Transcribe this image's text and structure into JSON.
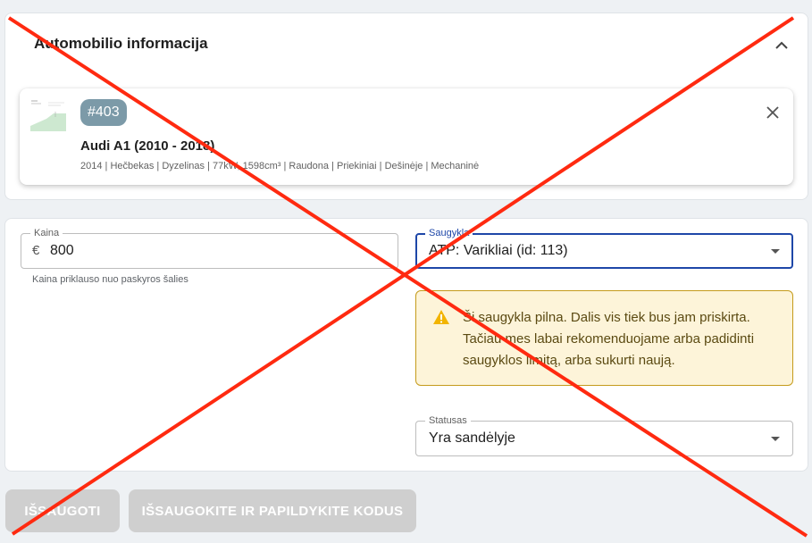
{
  "vehicle_section": {
    "title": "Automobilio informacija",
    "card": {
      "badge": "#403",
      "title": "Audi A1 (2010 - 2018)",
      "details": "2014 | Hečbekas | Dyzelinas | 77kW, 1598cm³ | Raudona | Priekiniai | Dešinėje | Mechaninė"
    }
  },
  "form": {
    "price": {
      "label": "Kaina",
      "currency": "€",
      "value": "800",
      "helper": "Kaina priklauso nuo paskyros šalies"
    },
    "storage": {
      "label": "Saugykla",
      "value": "ATP: Varikliai (id: 113)"
    },
    "warning": {
      "text": "Ši saugykla pilna. Dalis vis tiek bus jam priskirta. Tačiau mes labai rekomenduojame arba padidinti saugyklos limitą, arba sukurti naują."
    },
    "status": {
      "label": "Statusas",
      "value": "Yra sandėlyje"
    }
  },
  "actions": {
    "save_label": "IŠSAUGOTI",
    "save_codes_label": "IŠSAUGOKITE IR PAPILDYKITE KODUS"
  },
  "colors": {
    "background": "#eef1f4",
    "accent": "#1e47a8",
    "badge": "#7c9aa8",
    "warning_bg": "#fdf4d9",
    "warning_border": "#c59b1b",
    "warning_icon": "#f2b400",
    "overlay_cross": "#ff2a10",
    "disabled_button": "#cfcfcf"
  }
}
